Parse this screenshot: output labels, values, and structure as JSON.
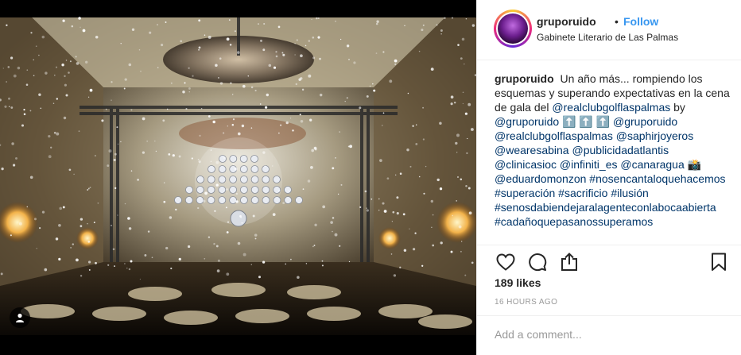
{
  "post": {
    "username": "gruporuido",
    "separator": "•",
    "follow_label": "Follow",
    "location": "Gabinete Literario de Las Palmas"
  },
  "caption": {
    "username": "gruporuido",
    "segments": [
      {
        "text": "Un año más... rompiendo los esquemas y superando expectativas en la cena de gala del ",
        "link": false
      },
      {
        "text": "@realclubgolflaspalmas",
        "link": true
      },
      {
        "text": " by ",
        "link": false
      },
      {
        "text": "@gruporuido",
        "link": true
      },
      {
        "text": " ⬆️ ⬆️ ⬆️ ",
        "link": false
      },
      {
        "text": "@gruporuido",
        "link": true
      },
      {
        "text": " ",
        "link": false
      },
      {
        "text": "@realclubgolflaspalmas",
        "link": true
      },
      {
        "text": " ",
        "link": false
      },
      {
        "text": "@saphirjoyeros",
        "link": true
      },
      {
        "text": " ",
        "link": false
      },
      {
        "text": "@wearesabina",
        "link": true
      },
      {
        "text": " ",
        "link": false
      },
      {
        "text": "@publicidadatlantis",
        "link": true
      },
      {
        "text": " ",
        "link": false
      },
      {
        "text": "@clinicasioc",
        "link": true
      },
      {
        "text": " ",
        "link": false
      },
      {
        "text": "@infiniti_es",
        "link": true
      },
      {
        "text": " ",
        "link": false
      },
      {
        "text": "@canaragua",
        "link": true
      },
      {
        "text": " 📸 ",
        "link": false
      },
      {
        "text": "@eduardomonzon",
        "link": true
      },
      {
        "text": " ",
        "link": false
      },
      {
        "text": "#nosencantaloquehacemos",
        "link": true
      },
      {
        "text": " ",
        "link": false
      },
      {
        "text": "#superación",
        "link": true
      },
      {
        "text": " ",
        "link": false
      },
      {
        "text": "#sacrificio",
        "link": true
      },
      {
        "text": " ",
        "link": false
      },
      {
        "text": "#ilusión",
        "link": true
      },
      {
        "text": " ",
        "link": false
      },
      {
        "text": "#senosdabiendejaralagenteconlabocaabierta",
        "link": true
      },
      {
        "text": " ",
        "link": false
      },
      {
        "text": "#cadañoquepasanossuperamos",
        "link": true
      }
    ]
  },
  "actions": {
    "like": "heart-icon",
    "comment": "comment-icon",
    "share": "share-icon",
    "save": "bookmark-icon"
  },
  "likes_label": "189 likes",
  "timestamp": "16 HOURS AGO",
  "comment_placeholder": "Add a comment...",
  "colors": {
    "link": "#003569",
    "follow": "#3897f0",
    "muted": "#999999",
    "text": "#262626"
  }
}
